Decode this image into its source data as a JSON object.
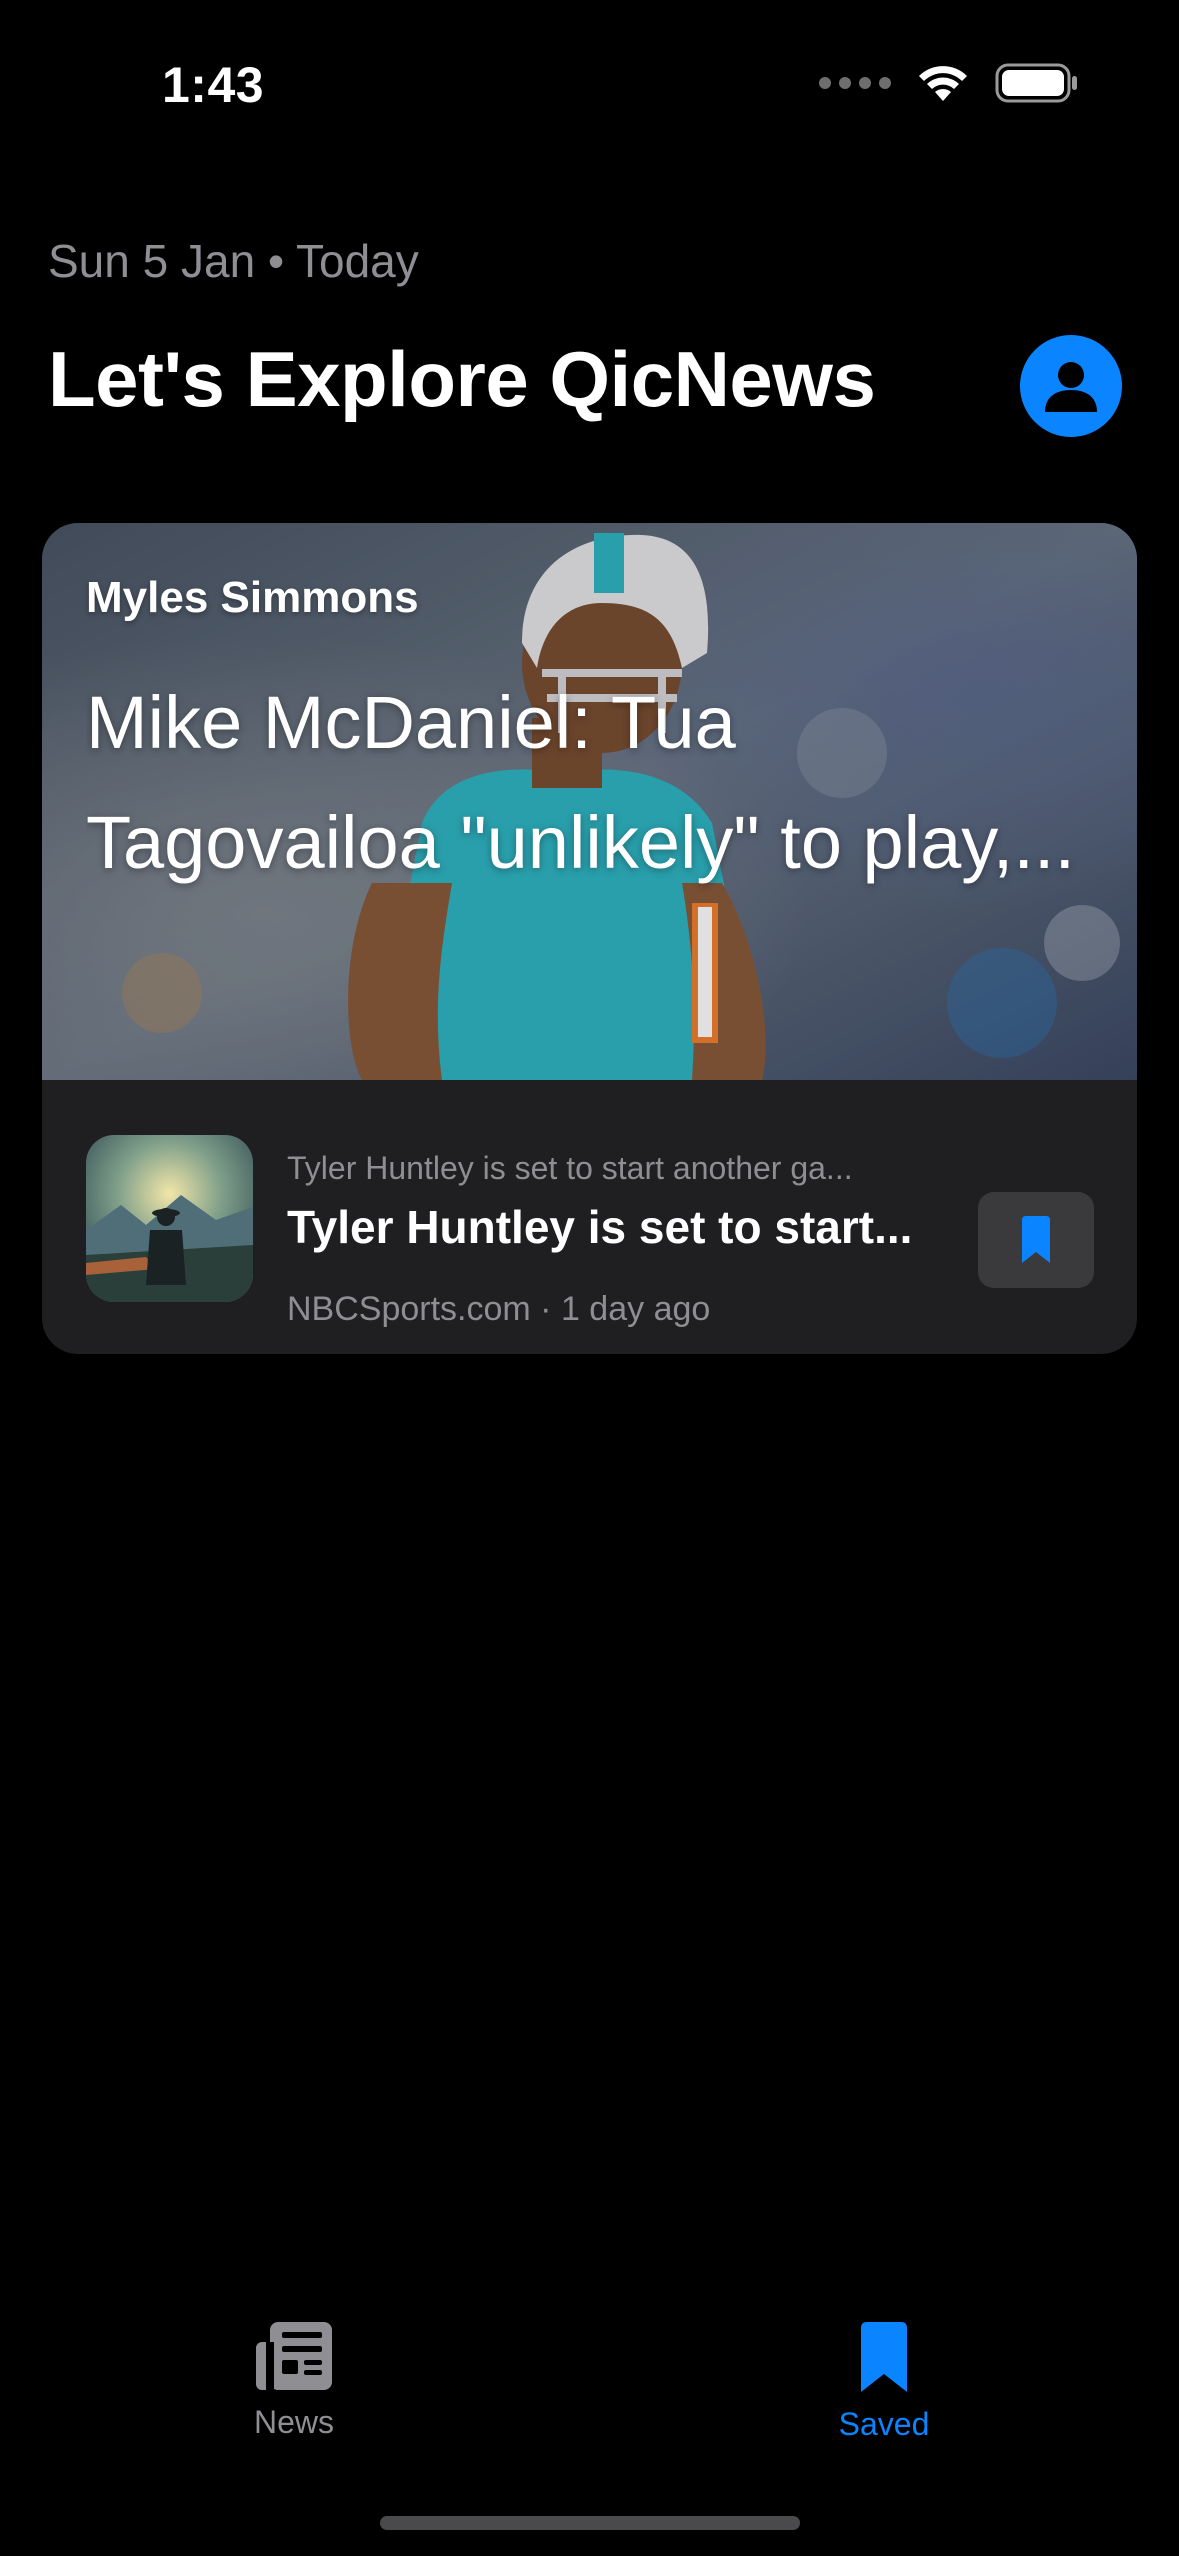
{
  "status_bar": {
    "time": "1:43"
  },
  "header": {
    "date_line": "Sun 5 Jan • Today",
    "title": "Let's Explore QicNews"
  },
  "featured": {
    "author": "Myles Simmons",
    "title_line1": "Mike McDaniel: Tua",
    "title_line2": "Tagovailoa \"unlikely\" to play,..."
  },
  "article": {
    "summary": "Tyler Huntley is set to start another ga...",
    "title": "Tyler Huntley is set to start...",
    "meta": "NBCSports.com · 1 day ago"
  },
  "tab_bar": {
    "tabs": [
      {
        "label": "News",
        "icon": "newspaper-icon",
        "active": false
      },
      {
        "label": "Saved",
        "icon": "bookmark-icon",
        "active": true
      }
    ]
  },
  "colors": {
    "accent": "#0a84ff",
    "background": "#000000",
    "card": "#1f1f21",
    "secondary_text": "#8e8e93"
  }
}
